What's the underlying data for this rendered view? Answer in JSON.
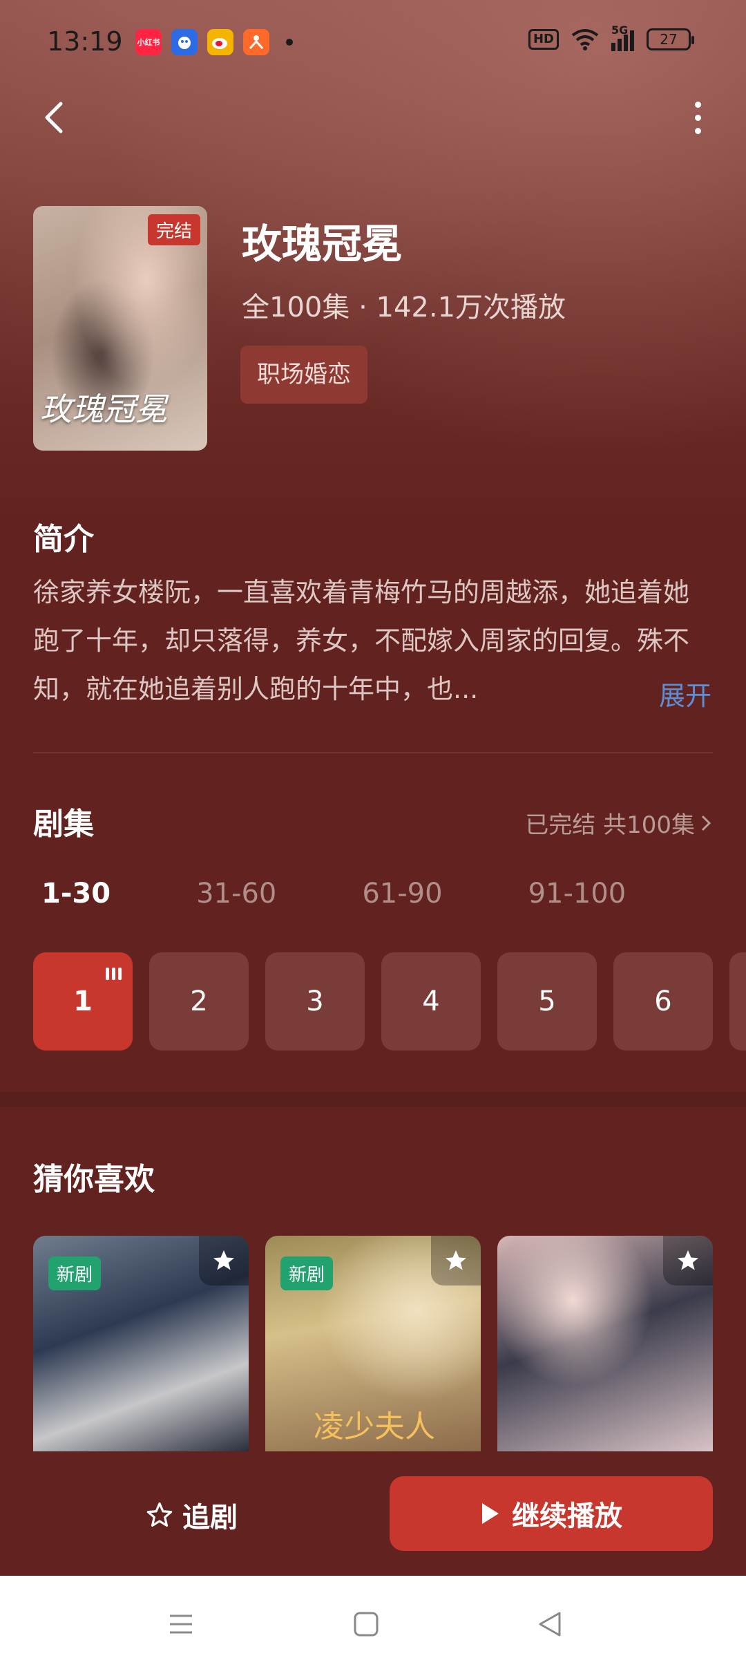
{
  "status_bar": {
    "time": "13:19",
    "app_icons": [
      {
        "name": "xiaohongshu-icon",
        "label": "小红书",
        "color": "#ff2442"
      },
      {
        "name": "baidu-icon",
        "label": "",
        "color": "#2d6be4"
      },
      {
        "name": "weibo-icon",
        "label": "",
        "color": "#f5b400"
      },
      {
        "name": "app-orange-icon",
        "label": "",
        "color": "#ff6a2b"
      }
    ],
    "network_badge": "HD",
    "network_type": "5G",
    "battery": "27"
  },
  "drama": {
    "title": "玫瑰冠冕",
    "episodes_total": "全100集",
    "plays": "142.1万次播放",
    "meta_separator": "·",
    "genre_tag": "职场婚恋",
    "poster_badge": "完结",
    "poster_title": "玫瑰冠冕"
  },
  "intro": {
    "title": "简介",
    "text": "徐家养女楼阮，一直喜欢着青梅竹马的周越添，她追着她跑了十年，却只落得，养女，不配嫁入周家的回复。殊不知，就在她追着别人跑的十年中，也...",
    "expand_label": "展开"
  },
  "episodes": {
    "title": "剧集",
    "status": "已完结 共100集",
    "ranges": [
      "1-30",
      "31-60",
      "61-90",
      "91-100"
    ],
    "active_range_index": 0,
    "items": [
      "1",
      "2",
      "3",
      "4",
      "5",
      "6"
    ],
    "active_episode_index": 0
  },
  "recommendations": {
    "title": "猜你喜欢",
    "items": [
      {
        "badge": "新剧",
        "caption": ""
      },
      {
        "badge": "新剧",
        "caption": "凌少夫人"
      },
      {
        "badge": "",
        "caption": ""
      }
    ]
  },
  "actions": {
    "follow_label": "追剧",
    "play_label": "继续播放"
  },
  "colors": {
    "accent": "#c8372d",
    "background": "#62221f",
    "link": "#5b8fd6",
    "new_badge": "#21a26f"
  }
}
